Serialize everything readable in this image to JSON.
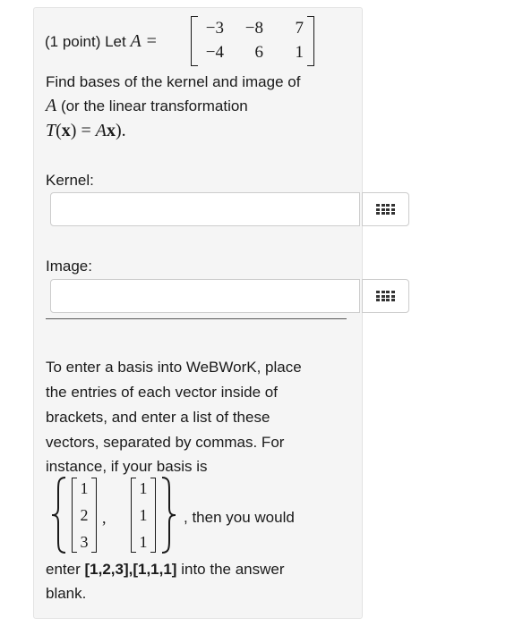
{
  "problem": {
    "points_prefix": "(1 point) Let ",
    "matrix_name": "A",
    "equals": "=",
    "matrix": [
      [
        "−3",
        "−8",
        "7"
      ],
      [
        "−4",
        "6",
        "1"
      ]
    ],
    "line2": "Find bases of the kernel and image of",
    "line3_var": "A",
    "line3_rest": " (or the linear transformation",
    "line4": "T(x) = Ax).",
    "line4_T": "T",
    "line4_open": "(",
    "line4_x": "x",
    "line4_close": ") = ",
    "line4_A": "A",
    "line4_x2": "x",
    "line4_end": ")."
  },
  "kernel": {
    "label": "Kernel:",
    "value": ""
  },
  "image": {
    "label": "Image:",
    "value": ""
  },
  "instructions": {
    "line1": "To enter a basis into WeBWorK, place",
    "line2": "the entries of each vector inside of",
    "line3": "brackets, and enter a list of these",
    "line4": "vectors, separated by commas. For",
    "line5": "instance, if your basis is",
    "vec1": [
      "1",
      "2",
      "3"
    ],
    "vec2": [
      "1",
      "1",
      "1"
    ],
    "comma": ",",
    "then_text": ", then you would",
    "enter_prefix": "enter ",
    "enter_example": "[1,2,3],[1,1,1]",
    "enter_suffix": " into the answer",
    "last_line": "blank."
  },
  "icons": {
    "matrix_button": "grid-icon"
  }
}
